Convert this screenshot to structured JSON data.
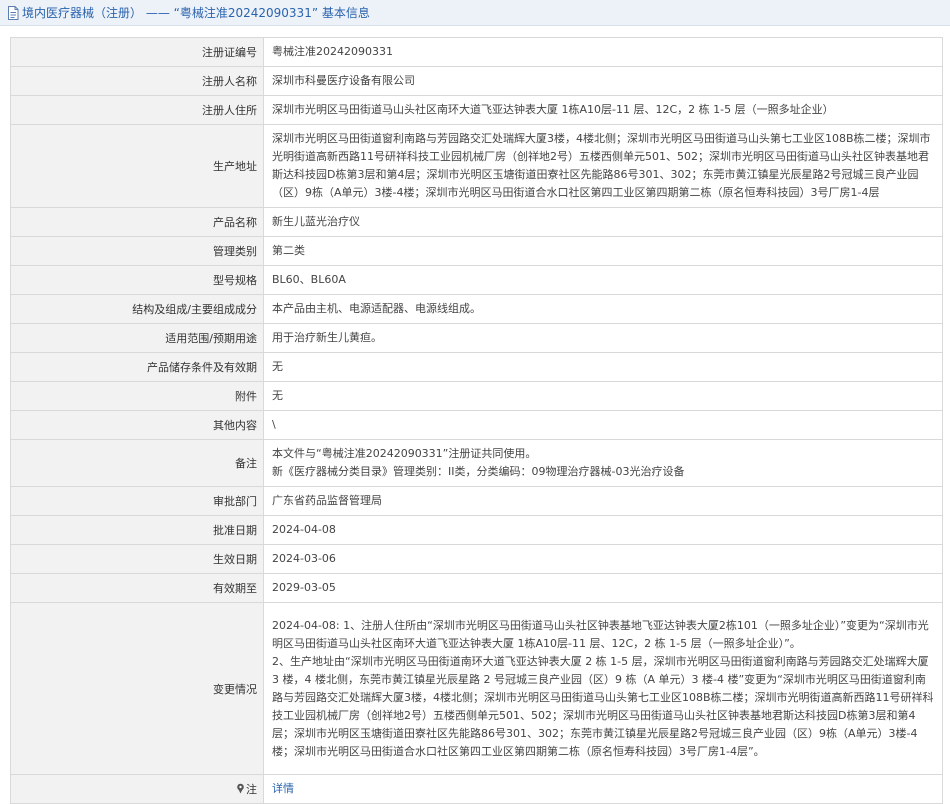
{
  "header": {
    "title": "境内医疗器械（注册） —— “粤械注准20242090331” 基本信息",
    "icon": "document-icon",
    "title_color": "#2a63ad"
  },
  "rows": [
    {
      "label": "注册证编号",
      "value": "粤械注准20242090331"
    },
    {
      "label": "注册人名称",
      "value": "深圳市科曼医疗设备有限公司"
    },
    {
      "label": "注册人住所",
      "value": "深圳市光明区马田街道马山头社区南环大道飞亚达钟表大厦 1栋A10层-11 层、12C，2 栋 1-5 层（一照多址企业）"
    },
    {
      "label": "生产地址",
      "value": "深圳市光明区马田街道窗利南路与芳园路交汇处瑞辉大厦3楼，4楼北侧；深圳市光明区马田街道马山头第七工业区108B栋二楼；深圳市光明街道高新西路11号研祥科技工业园机械厂房（创祥地2号）五楼西侧单元501、502；深圳市光明区马田街道马山头社区钟表基地君斯达科技园D栋第3层和第4层；深圳市光明区玉塘街道田寮社区先能路86号301、302；东莞市黄江镇星光辰星路2号冠城三良产业园（区）9栋（A单元）3楼-4楼；深圳市光明区马田街道合水口社区第四工业区第四期第二栋（原名恒寿科技园）3号厂房1-4层"
    },
    {
      "label": "产品名称",
      "value": "新生儿蓝光治疗仪"
    },
    {
      "label": "管理类别",
      "value": "第二类"
    },
    {
      "label": "型号规格",
      "value": "BL60、BL60A"
    },
    {
      "label": "结构及组成/主要组成成分",
      "value": "本产品由主机、电源适配器、电源线组成。"
    },
    {
      "label": "适用范围/预期用途",
      "value": "用于治疗新生儿黄疸。"
    },
    {
      "label": "产品储存条件及有效期",
      "value": "无"
    },
    {
      "label": "附件",
      "value": "无"
    },
    {
      "label": "其他内容",
      "value": "\\"
    },
    {
      "label": "备注",
      "lines": [
        "本文件与“粤械注准20242090331”注册证共同使用。",
        "新《医疗器械分类目录》管理类别：II类，分类编码：09物理治疗器械-03光治疗设备"
      ]
    },
    {
      "label": "审批部门",
      "value": "广东省药品监督管理局"
    },
    {
      "label": "批准日期",
      "value": "2024-04-08"
    },
    {
      "label": "生效日期",
      "value": "2024-03-06"
    },
    {
      "label": "有效期至",
      "value": "2029-03-05"
    },
    {
      "label": "变更情况",
      "lines": [
        "2024-04-08: 1、注册人住所由“深圳市光明区马田街道马山头社区钟表基地飞亚达钟表大厦2栋101（一照多址企业）”变更为“深圳市光明区马田街道马山头社区南环大道飞亚达钟表大厦 1栋A10层-11 层、12C，2 栋 1-5 层（一照多址企业）”。",
        "2、生产地址由“深圳市光明区马田街道南环大道飞亚达钟表大厦 2 栋 1-5 层，深圳市光明区马田街道窗利南路与芳园路交汇处瑞辉大厦 3 楼，4 楼北侧，东莞市黄江镇星光辰星路 2 号冠城三良产业园（区）9 栋（A 单元）3 楼-4 楼”变更为“深圳市光明区马田街道窗利南路与芳园路交汇处瑞辉大厦3楼，4楼北侧；深圳市光明区马田街道马山头第七工业区108B栋二楼；深圳市光明街道高新西路11号研祥科技工业园机械厂房（创祥地2号）五楼西侧单元501、502；深圳市光明区马田街道马山头社区钟表基地君斯达科技园D栋第3层和第4层；深圳市光明区玉塘街道田寮社区先能路86号301、302；东莞市黄江镇星光辰星路2号冠城三良产业园（区）9栋（A单元）3楼-4楼；深圳市光明区马田街道合水口社区第四工业区第四期第二栋（原名恒寿科技园）3号厂房1-4层”。"
      ]
    },
    {
      "label": "注",
      "icon": "pin-icon",
      "link": "详情"
    }
  ]
}
